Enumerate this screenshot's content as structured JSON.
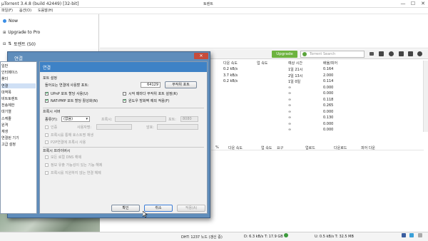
{
  "app": {
    "title": "µTorrent 3.4.8 (build 42449) [32-bit]",
    "center_title": "토렌트"
  },
  "window_buttons": [
    "—",
    "☐",
    "✕"
  ],
  "menu": [
    "파일(F)",
    "옵션(O)",
    "도움말(H)"
  ],
  "sidebar": {
    "now": "Now",
    "upgrade": "Upgrade to Pro",
    "torrents": "토렌트 (50)",
    "header_label": "토렌트"
  },
  "toolbar": {
    "upgrade_label": "Upgrade",
    "search_placeholder": "Torrent Search"
  },
  "torrent_list": {
    "columns": [
      "다운 속도",
      "업 속도",
      "예상 시간",
      "배율/피어"
    ],
    "rows": [
      [
        "0.2 kB/s",
        "",
        "1일 21시",
        "0.164"
      ],
      [
        "3.7 kB/s",
        "",
        "2일 13시",
        "2.000"
      ],
      [
        "0.2 kB/s",
        "",
        "1일 0일",
        "0.114"
      ],
      [
        "",
        "",
        "∞",
        "0.000"
      ],
      [
        "",
        "",
        "∞",
        "0.000"
      ],
      [
        "",
        "",
        "∞",
        "0.118"
      ],
      [
        "",
        "",
        "∞",
        "0.265"
      ],
      [
        "",
        "",
        "∞",
        "0.000"
      ],
      [
        "",
        "",
        "∞",
        "0.130"
      ],
      [
        "",
        "",
        "∞",
        "0.000"
      ],
      [
        "",
        "",
        "∞",
        "0.000"
      ]
    ]
  },
  "details": {
    "columns": [
      "%",
      "다운 속도",
      "업 속도",
      "요구",
      "업로드",
      "다운로드",
      "피어 다운"
    ]
  },
  "status": {
    "dht": "DHT: 1237 노드  (갱신 중)",
    "down": "D: 6.3 kB/s T: 17.9 GB",
    "up": "U: 0.5 kB/s T: 32.5 MB"
  },
  "dialog": {
    "title": "연결",
    "close": "✕",
    "tree": [
      "일반",
      "인터페이스",
      "폴더",
      "연결",
      "대역폭",
      "비트토렌트",
      "전송제한",
      "대기열",
      "스케줄",
      "원격",
      "재생",
      "연결된 기기",
      "고급 설정"
    ],
    "section": "연결",
    "port_group": "포트 설정",
    "port_label": "들어오는 연결에 사용할 포트:",
    "port_value": "64129",
    "random_port": "무작위 포트",
    "upnp": "UPnP 포트 할당 사용(U)",
    "natpmp": "NAT-PMP 포트 할당 활성화(N)",
    "random_start": "시작 때마다 무작위 포트 설정(R)",
    "firewall": "윈도우 방화벽 예외 적용(F)",
    "proxy_group": "프록시 서버",
    "proxy_type_label": "종류(Y):",
    "proxy_type": "(없음)",
    "proxy_label": "프록시:",
    "port_short": "포트:",
    "proxy_port": "8080",
    "auth": "인증",
    "user": "사용자명:",
    "pass": "암호:",
    "resolve": "프록시를 통해 호스트명 재생",
    "p2p": "P2P연결에 프록시 사용",
    "privacy_group": "프록시 프라이버시",
    "priv1": "모든 로컬 DNS 해제",
    "priv2": "정보 유출 가능성이 있는 기능 해제",
    "priv3": "프록시를 지원하지 않는 연결 해제",
    "ok": "확인",
    "cancel": "취소",
    "apply": "적용(A)"
  },
  "colors": {
    "upgrade_green": "#6db33f",
    "dialog_frame": "#5f8dbb",
    "dialog_bar": "#3e82c6"
  }
}
